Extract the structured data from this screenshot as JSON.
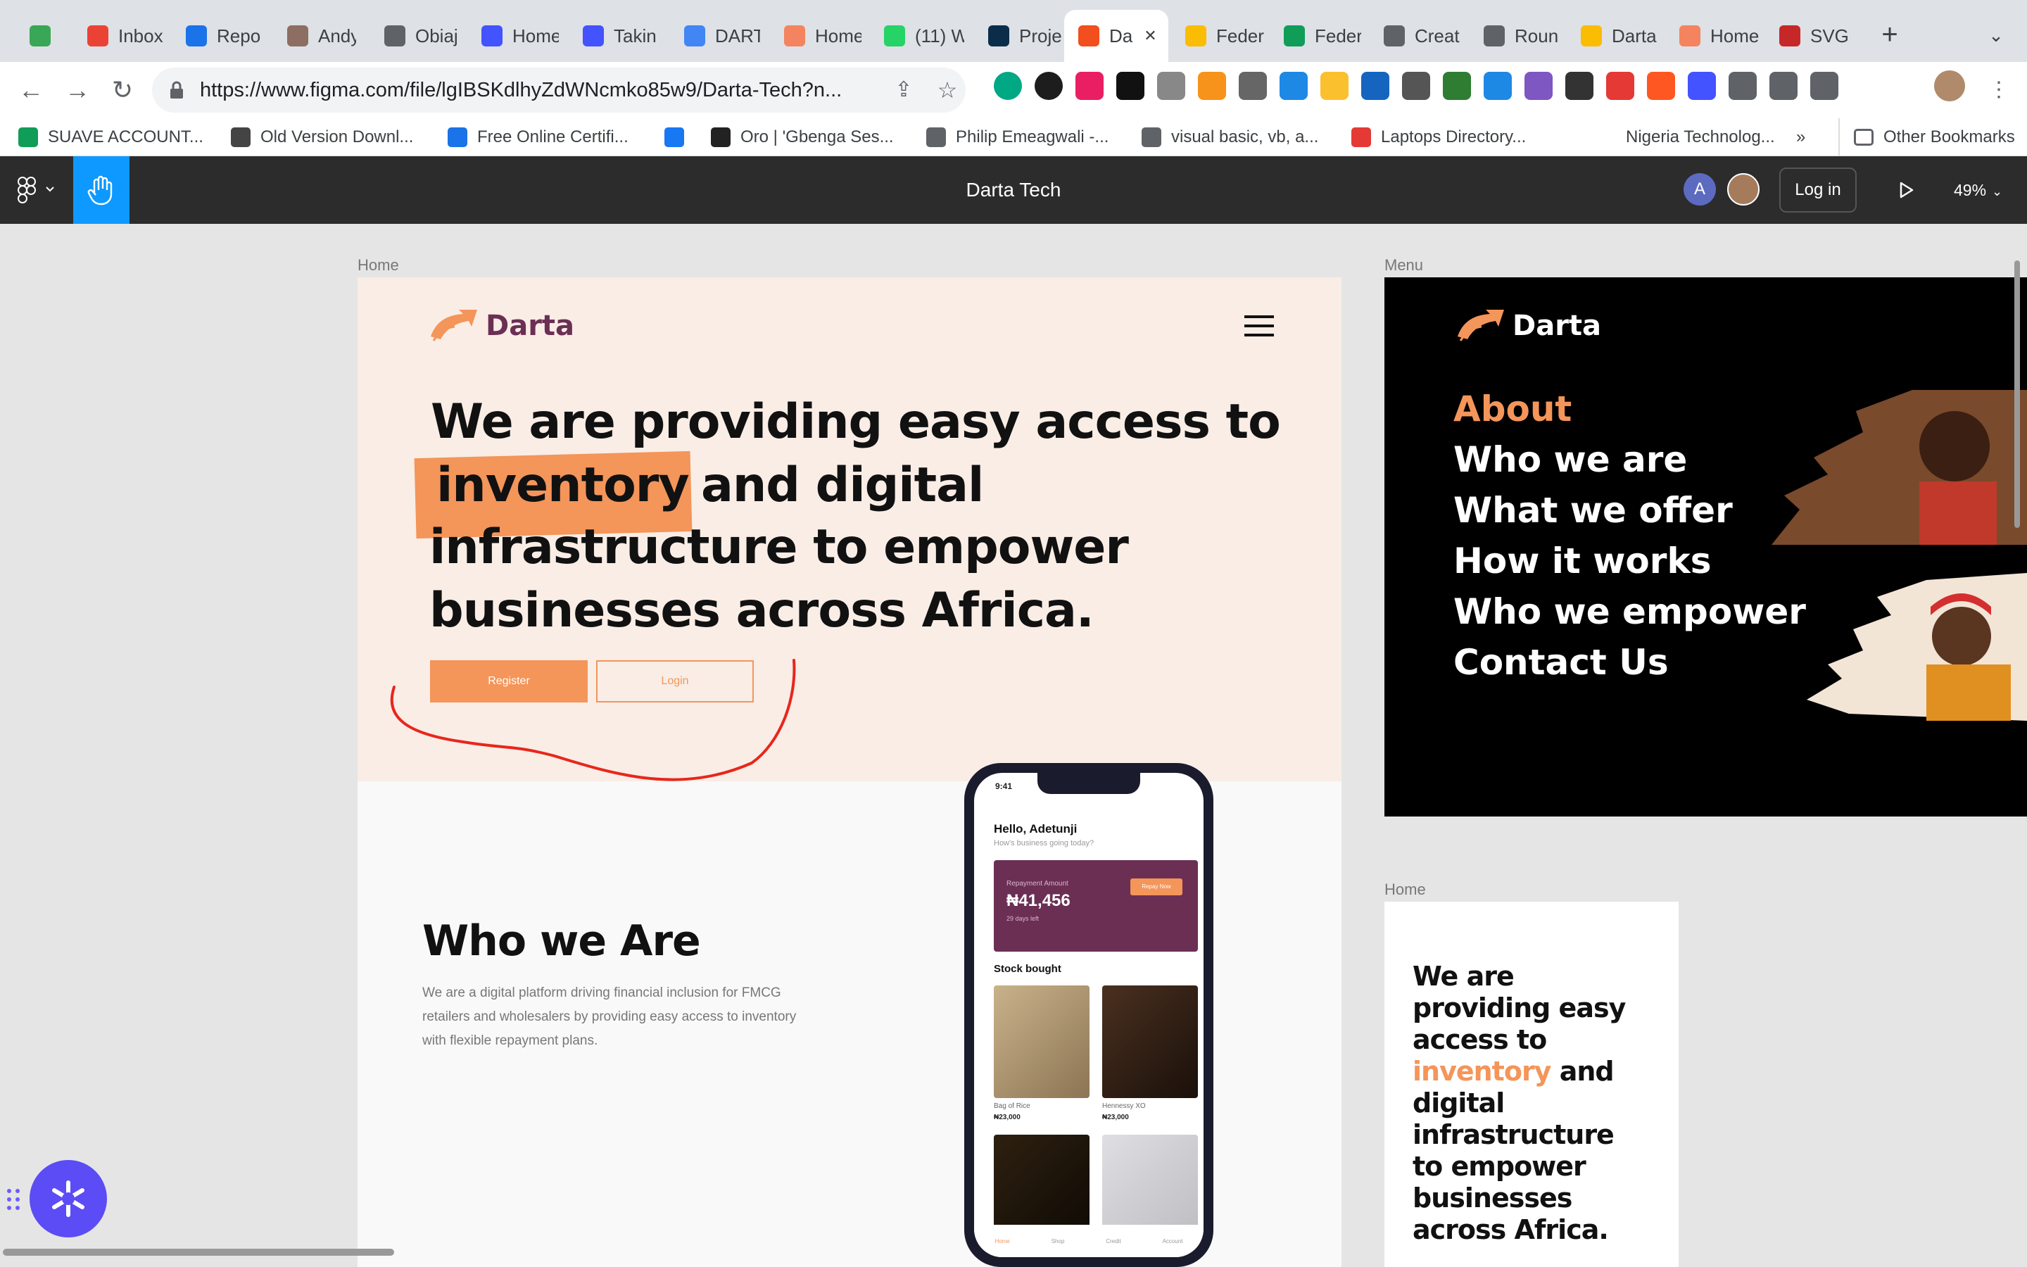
{
  "browser": {
    "tabs": [
      {
        "label": "",
        "color": "#3aa757"
      },
      {
        "label": "Inbox",
        "color": "#ea4335"
      },
      {
        "label": "Repo",
        "color": "#1a73e8"
      },
      {
        "label": "Andy",
        "color": "#8d6e63"
      },
      {
        "label": "Obiaj",
        "color": "#5f6368"
      },
      {
        "label": "Home",
        "color": "#4353ff"
      },
      {
        "label": "Takin",
        "color": "#4353ff"
      },
      {
        "label": "DART",
        "color": "#4285f4"
      },
      {
        "label": "Home",
        "color": "#f4845f"
      },
      {
        "label": "(11) W",
        "color": "#25d366"
      },
      {
        "label": "Proje",
        "color": "#0b2d4a"
      },
      {
        "label": "Da",
        "color": "#f24e1e"
      },
      {
        "label": "Feder",
        "color": "#fbbc04"
      },
      {
        "label": "Feder",
        "color": "#0f9d58"
      },
      {
        "label": "Creat",
        "color": "#5f6368"
      },
      {
        "label": "Roun",
        "color": "#5f6368"
      },
      {
        "label": "Darta",
        "color": "#fbbc04"
      },
      {
        "label": "Home",
        "color": "#f4845f"
      },
      {
        "label": "SVG",
        "color": "#c62828"
      }
    ],
    "new_tab": "+",
    "url": "https://www.figma.com/file/lgIBSKdlhyZdWNcmko85w9/Darta-Tech?n...",
    "bookmarks": [
      {
        "label": "SUAVE ACCOUNT...",
        "color": "#0f9d58"
      },
      {
        "label": "Old Version Downl...",
        "color": "#444"
      },
      {
        "label": "Free Online Certifi...",
        "color": "#1a73e8"
      },
      {
        "label": "",
        "color": "#1877f2"
      },
      {
        "label": "Oro | 'Gbenga Ses...",
        "color": "#222"
      },
      {
        "label": "Philip Emeagwali -...",
        "color": "#5f6368"
      },
      {
        "label": "visual basic, vb, a...",
        "color": "#5f6368"
      },
      {
        "label": "Laptops Directory...",
        "color": "#e53935"
      },
      {
        "label": "Nigeria Technolog...",
        "color": "#fff"
      }
    ],
    "bookmarks_more": "»",
    "other_bookmarks": "Other Bookmarks"
  },
  "figma": {
    "file_title": "Darta Tech",
    "avatar_letter": "A",
    "login_label": "Log in",
    "zoom": "49%"
  },
  "frames": {
    "home_label": "Home",
    "menu_label": "Menu",
    "home2_label": "Home"
  },
  "home": {
    "logo": "Darta",
    "headline": {
      "line1": "We are providing easy access to",
      "highlight": "inventory",
      "line2_rest": "and digital",
      "line3": "infrastructure to empower",
      "line4": "businesses across Africa."
    },
    "register": "Register",
    "login": "Login",
    "who_title": "Who we Are",
    "who_body": [
      "We are a digital platform driving financial inclusion for FMCG",
      "retailers and wholesalers by providing easy access to inventory",
      "with flexible repayment plans."
    ],
    "phone": {
      "time": "9:41",
      "greeting": "Hello, Adetunji",
      "sub": "How's business going today?",
      "repay_label": "Repayment Amount",
      "repay_btn": "Repay Now",
      "amount": "₦41,456",
      "days": "29 days left",
      "stock_title": "Stock bought",
      "items": [
        {
          "name": "Bag of Rice",
          "price": "₦23,000"
        },
        {
          "name": "Hennessy XO",
          "price": "₦23,000"
        }
      ],
      "nav": [
        "Home",
        "Shop",
        "Credit",
        "Account"
      ]
    }
  },
  "menu": {
    "logo": "Darta",
    "items": [
      "About",
      "Who we are",
      "What we offer",
      "How it works",
      "Who we empower",
      "Contact Us"
    ],
    "accent": "#f4955a"
  },
  "home2": {
    "lines": [
      "We are",
      "providing easy",
      "access to"
    ],
    "highlight": "inventory",
    "after_highlight": "and",
    "rest": [
      "digital",
      "infrastructure",
      "to empower",
      "businesses",
      "across Africa."
    ]
  },
  "colors": {
    "accent": "#f4955a",
    "purple": "#6b2f54",
    "hero_bg": "#f9ede6",
    "figma_bar": "#2c2c2c",
    "figma_blue": "#0d99ff"
  }
}
